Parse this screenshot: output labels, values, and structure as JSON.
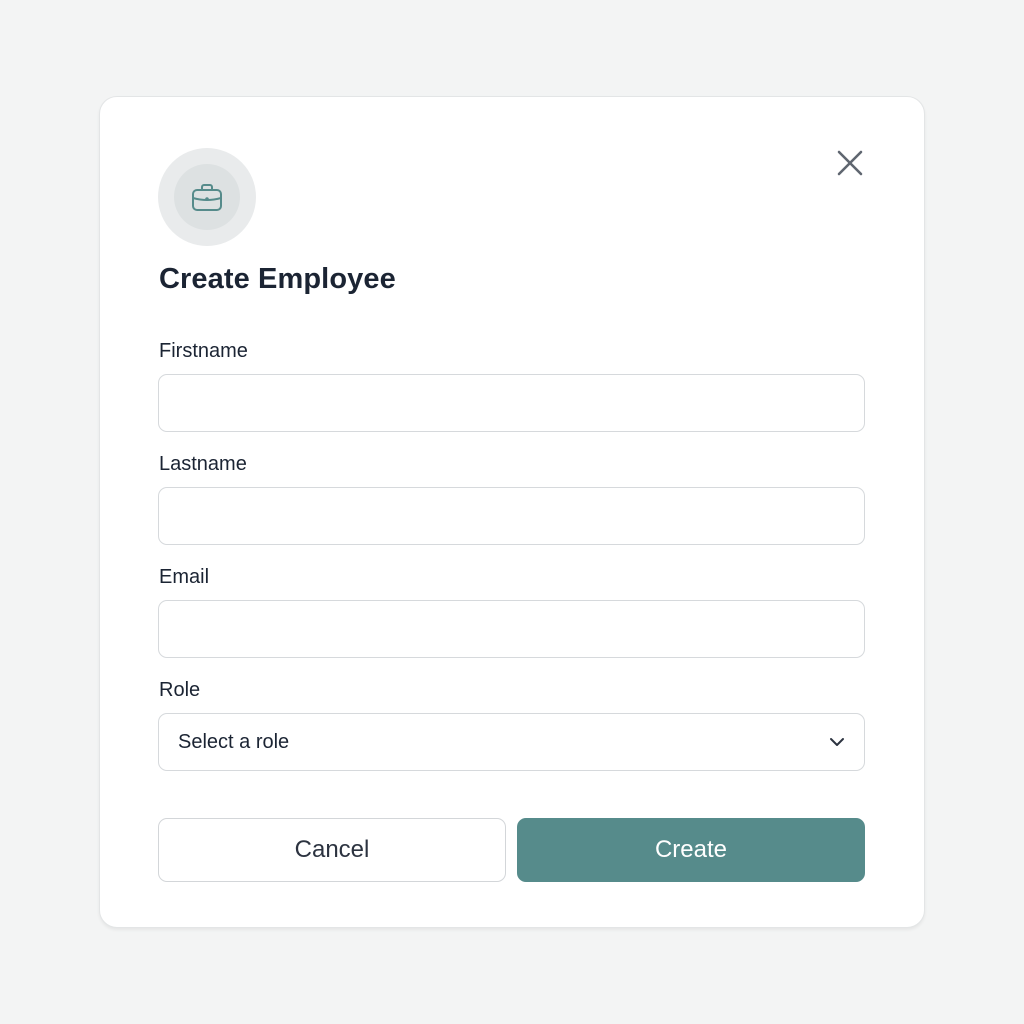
{
  "dialog": {
    "title": "Create Employee",
    "icon": "briefcase-icon",
    "close_icon": "close-icon"
  },
  "form": {
    "firstname": {
      "label": "Firstname",
      "value": "",
      "placeholder": ""
    },
    "lastname": {
      "label": "Lastname",
      "value": "",
      "placeholder": ""
    },
    "email": {
      "label": "Email",
      "value": "",
      "placeholder": ""
    },
    "role": {
      "label": "Role",
      "selected": "Select a role",
      "icon": "chevron-down-icon"
    }
  },
  "actions": {
    "cancel_label": "Cancel",
    "create_label": "Create"
  },
  "colors": {
    "accent": "#568b8b",
    "background": "#f3f4f4",
    "text": "#1b2433"
  }
}
